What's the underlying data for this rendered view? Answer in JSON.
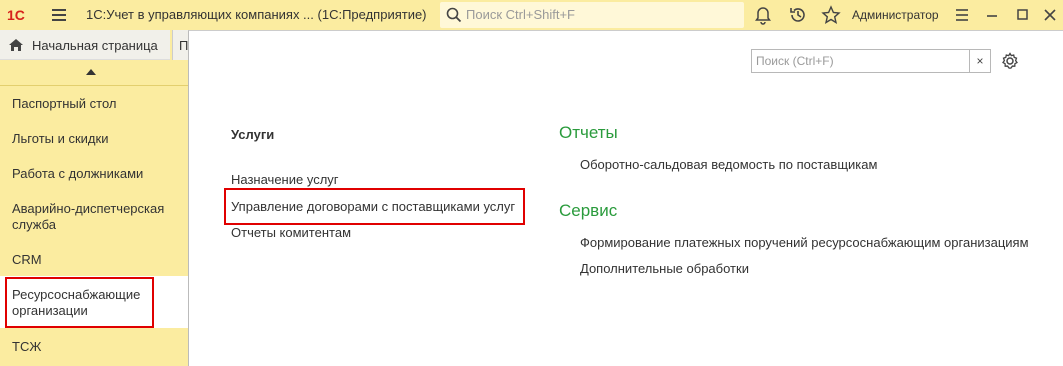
{
  "titlebar": {
    "logo_text": "1С",
    "app_title": "1С:Учет в управляющих компаниях ...  (1С:Предприятие)",
    "search_placeholder": "Поиск Ctrl+Shift+F",
    "user": "Администратор"
  },
  "tabs": {
    "home_label": "Начальная страница",
    "second_tab_stub": "П"
  },
  "sidebar": {
    "items": [
      {
        "label": "Паспортный стол"
      },
      {
        "label": "Льготы и скидки"
      },
      {
        "label": "Работа с должниками"
      },
      {
        "label": "Аварийно-диспетчерская служба"
      },
      {
        "label": "CRM"
      },
      {
        "label": "Ресурсоснабжающие организации",
        "active": true
      },
      {
        "label": "ТСЖ"
      }
    ]
  },
  "main": {
    "search_placeholder": "Поиск (Ctrl+F)",
    "clear_label": "×",
    "services": {
      "title": "Услуги",
      "links": [
        "Назначение услуг",
        "Управление договорами с поставщиками услуг",
        "Отчеты комитентам"
      ]
    },
    "reports": {
      "title": "Отчеты",
      "links": [
        "Оборотно-сальдовая ведомость по поставщикам"
      ]
    },
    "service": {
      "title": "Сервис",
      "links": [
        "Формирование платежных поручений ресурсоснабжающим организациям",
        "Дополнительные обработки"
      ]
    }
  },
  "colors": {
    "accent_yellow": "#fbeca0",
    "section_green": "#2a9b3c",
    "highlight_red": "#e00000"
  }
}
